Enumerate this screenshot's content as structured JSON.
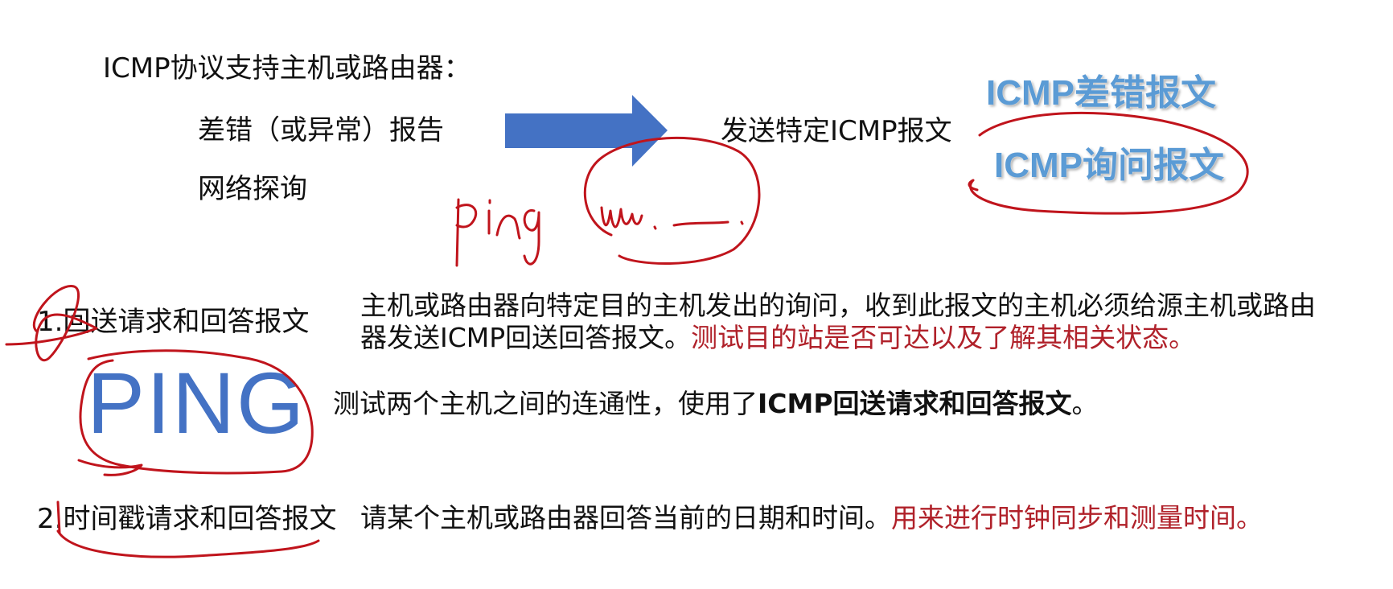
{
  "intro": {
    "heading": "ICMP协议支持主机或路由器：",
    "item1": "差错（或异常）报告",
    "item2": "网络探询",
    "result": "发送特定ICMP报文"
  },
  "types": {
    "error_msg": "ICMP差错报文",
    "query_msg": "ICMP询问报文"
  },
  "section1": {
    "title": "1.回送请求和回答报文",
    "desc_line1": "主机或路由器向特定目的主机发出的询问，收到此报文的主机必须给源主机或路由",
    "desc_line2_black": "器发送ICMP回送回答报文。",
    "desc_line2_red": "测试目的站是否可达以及了解其相关状态。"
  },
  "ping": {
    "word": "PING",
    "desc_plain": "测试两个主机之间的连通性，使用了",
    "desc_bold": "ICMP回送请求和回答报文",
    "desc_end": "。"
  },
  "section2": {
    "title": "2.时间戳请求和回答报文",
    "desc_black": "请某个主机或路由器回答当前的日期和时间。",
    "desc_red": "用来进行时钟同步和测量时间。"
  },
  "colors": {
    "arrow_fill": "#4472c4",
    "ink_red": "#c0141c",
    "title_blue": "#5b9bd5",
    "accent_red": "#b0212a"
  }
}
